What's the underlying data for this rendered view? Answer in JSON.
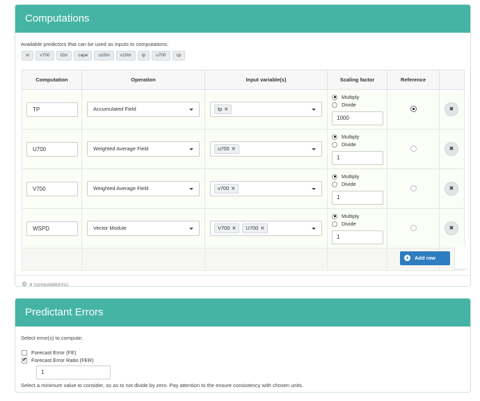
{
  "computations_panel": {
    "title": "Computations",
    "predictors_intro": "Available predictors that can be used as inputs to computations:",
    "predictors": [
      "sr",
      "v700",
      "t2m",
      "cape",
      "u10m",
      "v10m",
      "tp",
      "u700",
      "cp"
    ],
    "columns": [
      "Computation",
      "Operation",
      "Input variable(s)",
      "Scaling factor",
      "Reference"
    ],
    "rows": [
      {
        "name": "TP",
        "operation": "Accumulated Field",
        "inputs": [
          "tp"
        ],
        "scaling_mode": "Multiply",
        "scaling_value": "1000",
        "reference": true
      },
      {
        "name": "U700",
        "operation": "Weighted Average Field",
        "inputs": [
          "u700"
        ],
        "scaling_mode": "Multiply",
        "scaling_value": "1",
        "reference": false
      },
      {
        "name": "V700",
        "operation": "Weighted Average Field",
        "inputs": [
          "v700"
        ],
        "scaling_mode": "Multiply",
        "scaling_value": "1",
        "reference": false
      },
      {
        "name": "WSPD",
        "operation": "Vector Module",
        "inputs": [
          "V700",
          "U700"
        ],
        "scaling_mode": "Multiply",
        "scaling_value": "1",
        "reference": false
      }
    ],
    "scaling_options": [
      "Multiply",
      "Divide"
    ],
    "add_row_label": "Add row",
    "count_text": "4 computation(s)."
  },
  "errors_panel": {
    "title": "Predictant Errors",
    "intro": "Select error(s) to compute:",
    "options": [
      {
        "label": "Forecast Error (FE)",
        "checked": false
      },
      {
        "label": "Forecast Error Ratio (FER)",
        "checked": true
      }
    ],
    "min_value": "1",
    "min_note": "Select a minimum value to consider, so as to not divide by zero. Pay attention to the ensure consistency with chosen units."
  },
  "colors": {
    "header": "#45b4a4",
    "add_button": "#2e7dc0"
  }
}
